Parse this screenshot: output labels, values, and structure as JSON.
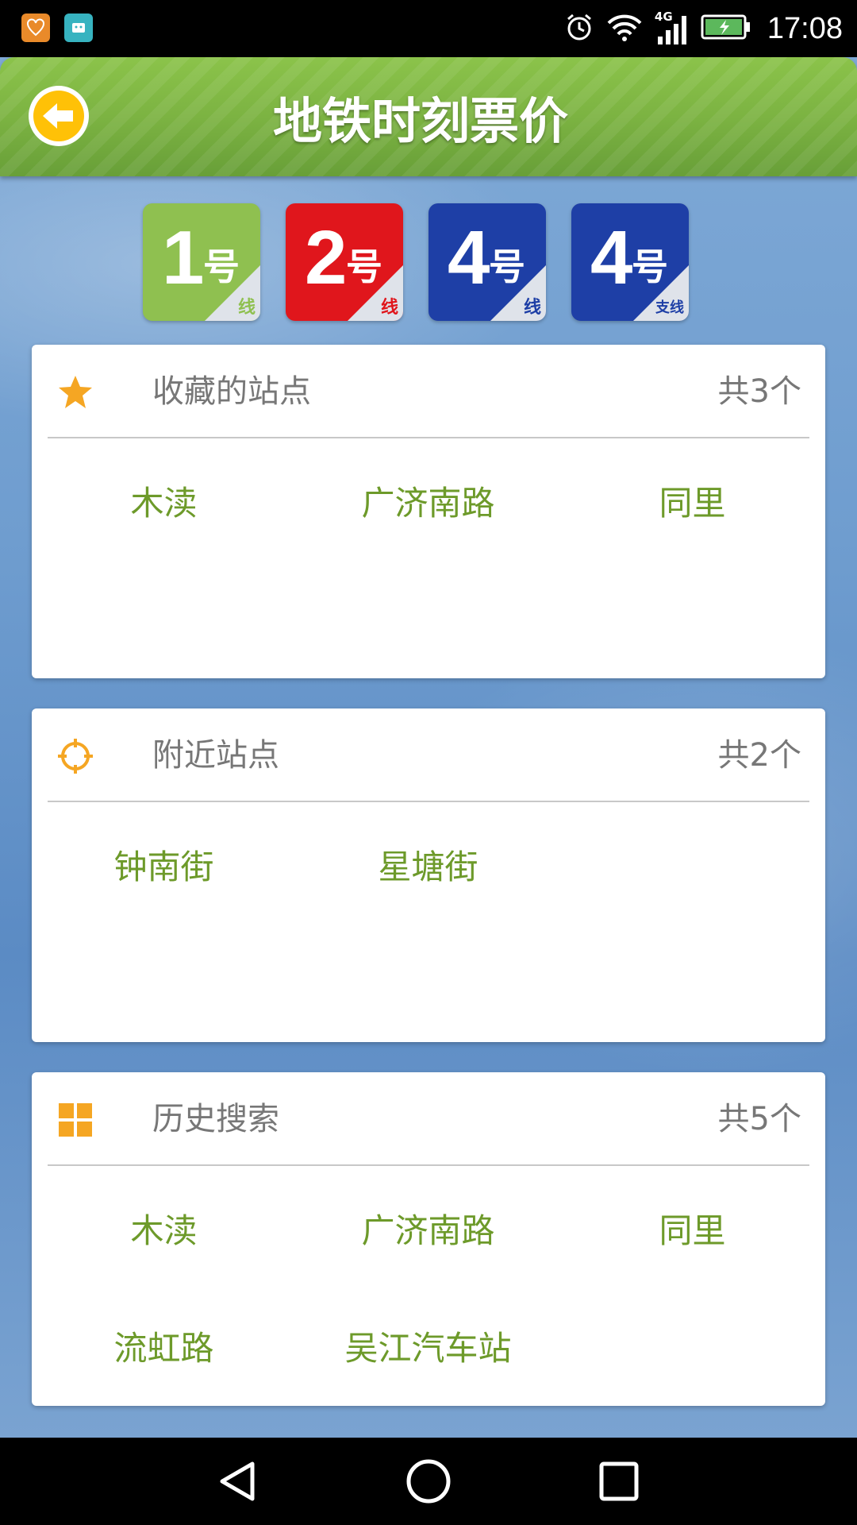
{
  "status_bar": {
    "time": "17:08",
    "network": "4G",
    "icons": [
      "health-app-icon",
      "android-app-icon",
      "alarm-icon",
      "wifi-icon",
      "signal-icon",
      "battery-charging-icon"
    ]
  },
  "header": {
    "title": "地铁时刻票价",
    "back_icon": "back-arrow-icon"
  },
  "lines": [
    {
      "number": "1",
      "hao": "号",
      "sub": "线",
      "color": "#8fc050",
      "sub_color": "#8fc050"
    },
    {
      "number": "2",
      "hao": "号",
      "sub": "线",
      "color": "#e0161c",
      "sub_color": "#e0161c"
    },
    {
      "number": "4",
      "hao": "号",
      "sub": "线",
      "color": "#1e3fa6",
      "sub_color": "#1e3fa6"
    },
    {
      "number": "4",
      "hao": "号",
      "sub": "支线",
      "color": "#1e3fa6",
      "sub_color": "#1e3fa6"
    }
  ],
  "sections": {
    "favorites": {
      "title": "收藏的站点",
      "count": "共3个",
      "icon": "star-icon",
      "stations": [
        "木渎",
        "广济南路",
        "同里"
      ]
    },
    "nearby": {
      "title": "附近站点",
      "count": "共2个",
      "icon": "location-target-icon",
      "stations": [
        "钟南街",
        "星塘街"
      ]
    },
    "history": {
      "title": "历史搜索",
      "count": "共5个",
      "icon": "grid-icon",
      "stations": [
        "木渎",
        "广济南路",
        "同里",
        "流虹路",
        "吴江汽车站"
      ]
    }
  },
  "colors": {
    "accent_green": "#7cb342",
    "station_text": "#6d9a2a",
    "icon_orange": "#f5a623"
  },
  "nav_bar": {
    "icons": [
      "back-triangle-icon",
      "home-circle-icon",
      "recents-square-icon"
    ]
  }
}
